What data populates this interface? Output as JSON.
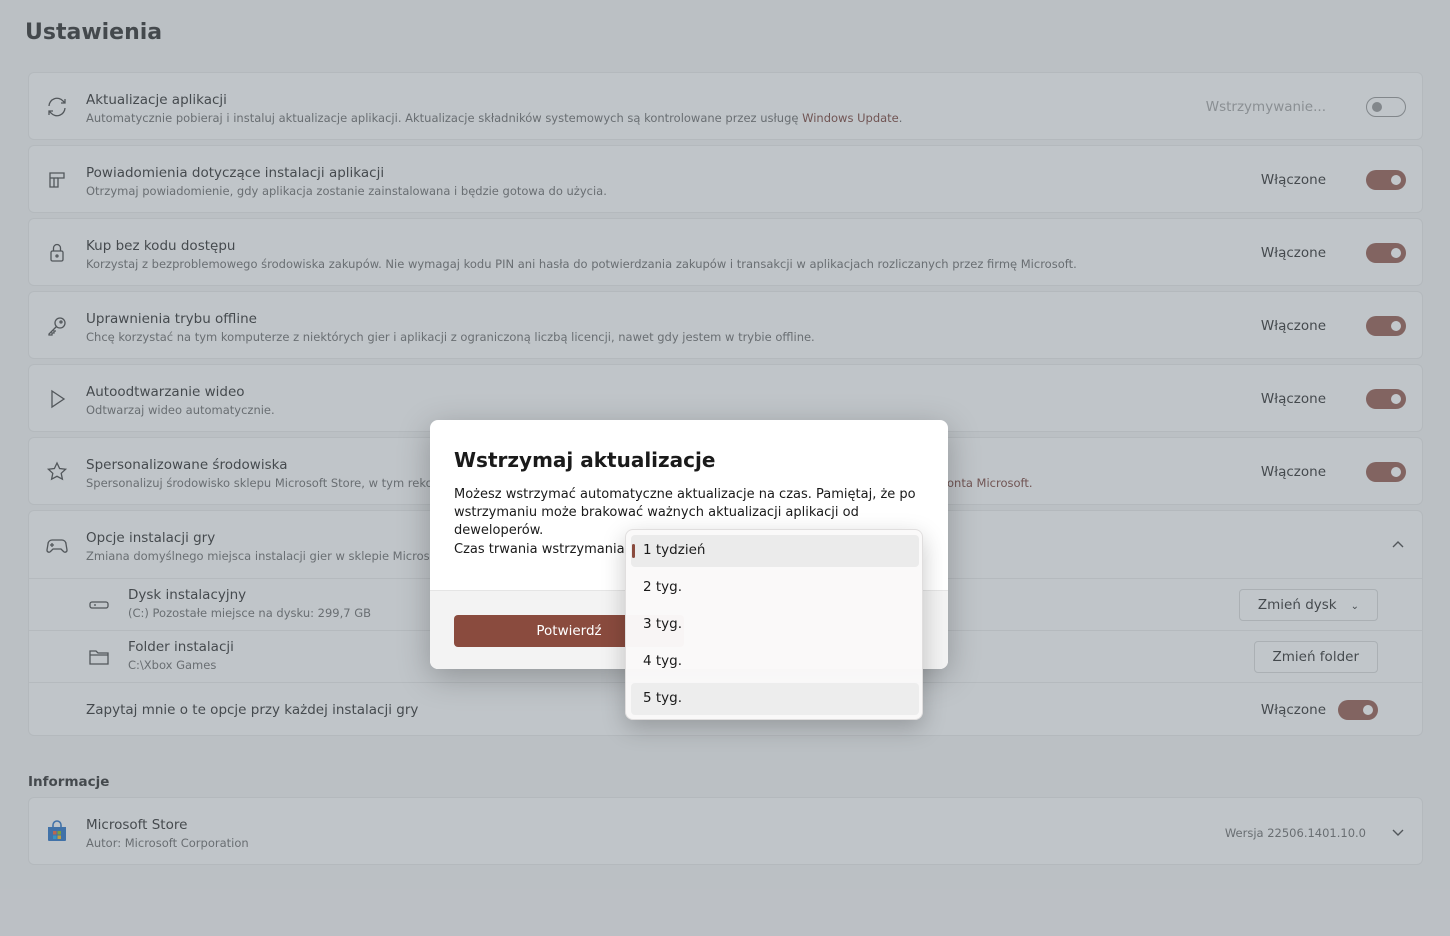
{
  "page": {
    "title": "Ustawienia"
  },
  "settings": [
    {
      "title": "Aktualizacje aplikacji",
      "desc": "Automatycznie pobieraj i instaluj aktualizacje aplikacji. Aktualizacje składników systemowych są kontrolowane przez usługę ",
      "link": "Windows Update",
      "desc_after": ".",
      "state": "Wstrzymywanie...",
      "on": false
    },
    {
      "title": "Powiadomienia dotyczące instalacji aplikacji",
      "desc": "Otrzymaj powiadomienie, gdy aplikacja zostanie zainstalowana i będzie gotowa do użycia.",
      "state": "Włączone",
      "on": true
    },
    {
      "title": "Kup bez kodu dostępu",
      "desc": "Korzystaj z bezproblemowego środowiska zakupów. Nie wymagaj kodu PIN ani hasła do potwierdzania zakupów i transakcji w aplikacjach rozliczanych przez firmę Microsoft.",
      "state": "Włączone",
      "on": true
    },
    {
      "title": "Uprawnienia trybu offline",
      "desc": "Chcę korzystać na tym komputerze z niektórych gier i aplikacji z ograniczoną liczbą licencji, nawet gdy jestem w trybie offline.",
      "state": "Włączone",
      "on": true
    },
    {
      "title": "Autoodtwarzanie wideo",
      "desc": "Odtwarzaj wideo automatycznie.",
      "state": "Włączone",
      "on": true
    },
    {
      "title": "Spersonalizowane środowiska",
      "desc": "Spersonalizuj środowisko sklepu Microsoft Store, w tym rekome",
      "link_tail": "onta Microsoft.",
      "state": "Włączone",
      "on": true
    }
  ],
  "game_options": {
    "title": "Opcje instalacji gry",
    "desc": "Zmiana domyślnego miejsca instalacji gier w sklepie Microsoft S",
    "drive": {
      "title": "Dysk instalacyjny",
      "desc": "(C:) Pozostałe miejsce na dysku: 299,7 GB",
      "button": "Zmień dysk"
    },
    "folder": {
      "title": "Folder instalacji",
      "desc": "C:\\Xbox Games",
      "button": "Zmień folder"
    },
    "ask": {
      "title": "Zapytaj mnie o te opcje przy każdej instalacji gry",
      "state": "Włączone"
    }
  },
  "info": {
    "section": "Informacje",
    "title": "Microsoft Store",
    "author": "Autor: Microsoft Corporation",
    "version": "Wersja 22506.1401.10.0"
  },
  "dialog": {
    "title": "Wstrzymaj aktualizacje",
    "text": "Możesz wstrzymać automatyczne aktualizacje na czas. Pamiętaj, że po wstrzymaniu może brakować ważnych aktualizacji aplikacji od deweloperów.",
    "label": "Czas trwania wstrzymania",
    "confirm": "Potwierdź",
    "options": [
      "1 tydzień",
      "2 tyg.",
      "3 tyg.",
      "4 tyg.",
      "5 tyg."
    ],
    "selected": "1 tydzień"
  },
  "colors": {
    "accent": "#8a4b3e",
    "link": "#6b2f26"
  }
}
